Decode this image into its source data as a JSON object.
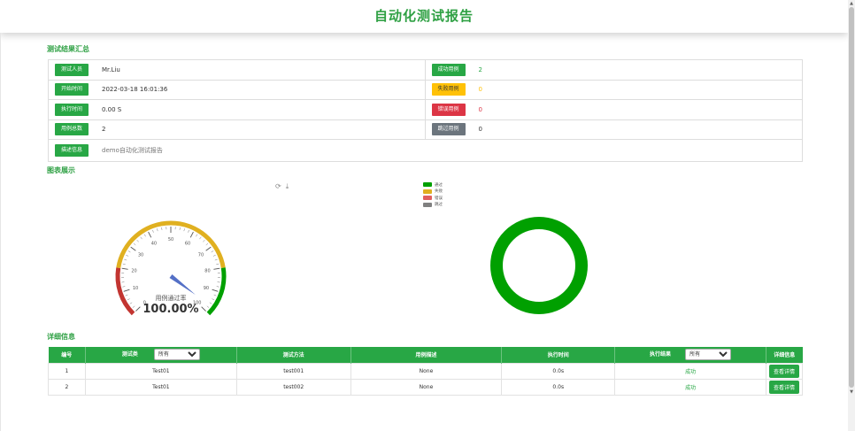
{
  "header": {
    "title": "自动化测试报告"
  },
  "summary": {
    "title": "测试结果汇总",
    "rows": [
      {
        "left_label": "测试人员",
        "left_value": "Mr.Liu",
        "right_label": "成功用例",
        "right_value": "2"
      },
      {
        "left_label": "开始时间",
        "left_value": "2022-03-18 16:01:36",
        "right_label": "失败用例",
        "right_value": "0"
      },
      {
        "left_label": "执行时间",
        "left_value": "0.00 S",
        "right_label": "错误用例",
        "right_value": "0"
      },
      {
        "left_label": "用例总数",
        "left_value": "2",
        "right_label": "跳过用例",
        "right_value": "0"
      }
    ],
    "desc_label": "描述信息",
    "desc_value": "demo自动化测试报告"
  },
  "charts": {
    "title": "图表展示",
    "gauge_label": "用例通过率",
    "gauge_value": "100.00%",
    "gauge_ticks": [
      "0",
      "10",
      "20",
      "30",
      "40",
      "50",
      "60",
      "70",
      "80",
      "90",
      "100"
    ],
    "legend": [
      "通过",
      "失败",
      "错误",
      "跳过"
    ],
    "colors": {
      "pass": "#00a000",
      "fail": "#e0b020",
      "error": "#e06060",
      "skip": "#808080",
      "accent": "#2ea043"
    }
  },
  "chart_data": [
    {
      "type": "gauge",
      "title": "",
      "value": 100.0,
      "range": [
        0,
        100
      ],
      "label": "用例通过率"
    },
    {
      "type": "pie",
      "categories": [
        "通过",
        "失败",
        "错误",
        "跳过"
      ],
      "values": [
        2,
        0,
        0,
        0
      ]
    }
  ],
  "details": {
    "title": "详细信息",
    "columns": [
      "编号",
      "测试类",
      "测试方法",
      "用例描述",
      "执行时间",
      "执行结果",
      "详细信息"
    ],
    "class_filter": "所有",
    "result_filter": "所有",
    "rows": [
      {
        "no": "1",
        "cls": "Test01",
        "method": "test001",
        "desc": "None",
        "time": "0.0s",
        "result": "成功",
        "action": "查看详情"
      },
      {
        "no": "2",
        "cls": "Test01",
        "method": "test002",
        "desc": "None",
        "time": "0.0s",
        "result": "成功",
        "action": "查看详情"
      }
    ]
  }
}
